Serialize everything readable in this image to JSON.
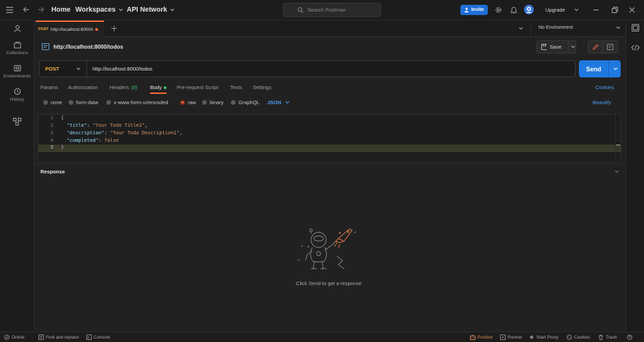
{
  "topbar": {
    "home": "Home",
    "workspaces": "Workspaces",
    "api_network": "API Network",
    "search_placeholder": "Search Postman",
    "invite": "Invite",
    "upgrade": "Upgrade"
  },
  "sidebar": {
    "items": [
      {
        "label": "",
        "icon": "user-icon"
      },
      {
        "label": "Collections",
        "icon": "collections-icon"
      },
      {
        "label": "Environments",
        "icon": "environments-icon"
      },
      {
        "label": "History",
        "icon": "history-icon"
      },
      {
        "label": "",
        "icon": "flows-icon"
      }
    ]
  },
  "tabs": {
    "active_method": "POST",
    "active_url": "http://localhost:8000/t",
    "environment": "No Environment"
  },
  "request": {
    "title": "http://localhost:8000/todos",
    "save_label": "Save",
    "method": "POST",
    "url": "http://localhost:8000/todos",
    "send_label": "Send"
  },
  "subtabs": {
    "params": "Params",
    "authorization": "Authorization",
    "headers": "Headers",
    "headers_count": "(8)",
    "body": "Body",
    "prerequest": "Pre-request Script",
    "tests": "Tests",
    "settings": "Settings",
    "cookies": "Cookies"
  },
  "body_options": {
    "none": "none",
    "form_data": "form-data",
    "urlencoded": "x-www-form-urlencoded",
    "raw": "raw",
    "binary": "binary",
    "graphql": "GraphQL",
    "format": "JSON",
    "beautify": "Beautify"
  },
  "editor": {
    "lines": [
      {
        "num": "1",
        "text": "{"
      },
      {
        "num": "2",
        "key": "\"title\"",
        "value": "\"Your Todo Title1\"",
        "tail": ","
      },
      {
        "num": "3",
        "key": "\"description\"",
        "value": "\"Your Todo Description1\"",
        "tail": ","
      },
      {
        "num": "4",
        "key": "\"completed\"",
        "value": "false",
        "tail": ""
      },
      {
        "num": "5",
        "text": "}"
      }
    ]
  },
  "response": {
    "title": "Response",
    "empty_message": "Click Send to get a response"
  },
  "statusbar": {
    "online": "Online",
    "find_replace": "Find and replace",
    "console": "Console",
    "postbot": "Postbot",
    "runner": "Runner",
    "start_proxy": "Start Proxy",
    "cookies": "Cookies",
    "trash": "Trash"
  },
  "colors": {
    "accent": "#ff6c37",
    "send": "#2079e0",
    "method": "#f5b33f",
    "invite": "#1f6fd6"
  }
}
